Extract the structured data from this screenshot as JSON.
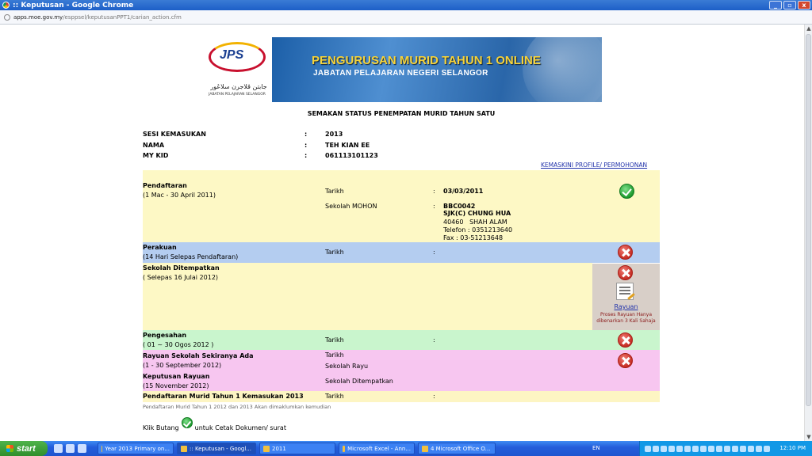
{
  "window": {
    "title": ":: Keputusan - Google Chrome",
    "min": "_",
    "max": "▫",
    "close": "x"
  },
  "address": {
    "host": "apps.moe.gov.my",
    "path": "/esppsel/keputusanPPT1/carian_action.cfm"
  },
  "banner": {
    "logo_text": "JPS",
    "logo_jawi": "جابتن ڤلاجرن سلاڠور",
    "logo_caption": "JABATAN PELAJARAN SELANGOR",
    "title": "PENGURUSAN MURID TAHUN 1 ONLINE",
    "subtitle": "JABATAN PELAJARAN NEGERI SELANGOR"
  },
  "page_title": "SEMAKAN STATUS PENEMPATAN MURID TAHUN SATU",
  "info": [
    {
      "label": "SESI KEMASUKAN",
      "colon": ":",
      "value": "2013"
    },
    {
      "label": "NAMA",
      "colon": ":",
      "value": "TEH KIAN EE"
    },
    {
      "label": "MY KID",
      "colon": ":",
      "value": "061113101123"
    }
  ],
  "profile_link": "KEMASKINI PROFILE/ PERMOHONAN",
  "rows": {
    "pendaftaran": {
      "title": "Pendaftaran",
      "period": "(1 Mac - 30 April 2011)",
      "tarikh_label": "Tarikh",
      "colon": ":",
      "tarikh_value": "03/03/2011",
      "sekolah_label": "Sekolah MOHON",
      "school_code": "BBC0042",
      "school_name": "SJK(C) CHUNG HUA",
      "school_addr": "40460   SHAH ALAM",
      "school_tel": "Telefon : 0351213640",
      "school_fax": "Fax : 03-51213648"
    },
    "perakuan": {
      "title": "Perakuan",
      "period": "(14 Hari Selepas Pendaftaran)",
      "tarikh_label": "Tarikh",
      "colon": ":"
    },
    "ditempatkan": {
      "title": "Sekolah Ditempatkan",
      "period": "( Selepas 16 Julai 2012)",
      "rayuan_link": "Rayuan",
      "rayuan_note": "Proses Rayuan Hanya dibenarkan 3 Kali Sahaja"
    },
    "pengesahan": {
      "title": "Pengesahan",
      "period": "( 01 ~ 30 Ogos 2012 )",
      "tarikh_label": "Tarikh",
      "colon": ":"
    },
    "rayuan": {
      "title": "Rayuan Sekolah Sekiranya Ada",
      "period": "(1 - 30 September 2012)",
      "tarikh_label": "Tarikh",
      "sekolah_label": "Sekolah Rayu",
      "kep_title": "Keputusan Rayuan",
      "kep_period": "(15 November 2012)",
      "kep_label": "Sekolah Ditempatkan"
    },
    "pendaftaran2013": {
      "title": "Pendaftaran Murid Tahun 1 Kemasukan 2013",
      "tarikh_label": "Tarikh",
      "colon": ":"
    }
  },
  "footnote": "Pendaftaran Murid Tahun 1 2012 dan 2013 Akan dimaklumkan kemudian",
  "klik": {
    "before": "Klik Butang",
    "after": "untuk Cetak Dokumen/ surat"
  },
  "taskbar": {
    "start": "start",
    "tasks": [
      "Year 2013 Primary on...",
      ":: Keputusan - Googl...",
      "2011",
      "Microsoft Excel - Ann...",
      "4 Microsoft Office O..."
    ],
    "lang": "EN",
    "clock": "12:10 PM"
  }
}
